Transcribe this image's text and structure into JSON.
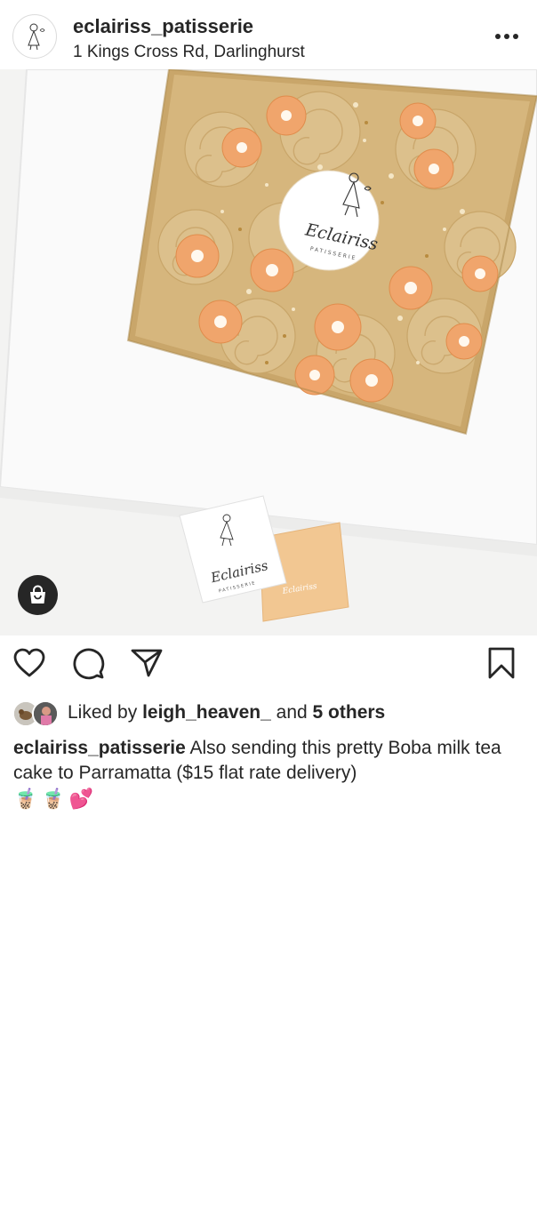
{
  "post": {
    "username": "eclairiss_patisserie",
    "location": "1 Kings Cross Rd, Darlinghurst",
    "image": {
      "logo_script": "Eclairiss",
      "logo_sub": "PATISSERIE"
    },
    "likes": {
      "prefix": "Liked by",
      "user": "leigh_heaven_",
      "joiner": "and",
      "others": "5 others"
    },
    "caption": {
      "username": "eclairiss_patisserie",
      "text": "Also sending this pretty Boba milk tea cake to Parramatta ($15 flat rate delivery)",
      "emojis": "🧋🧋💕"
    }
  },
  "icons": {
    "more": "more-horizontal-icon",
    "shop": "shopping-bag-icon",
    "like": "heart-icon",
    "comment": "comment-bubble-icon",
    "share": "paper-plane-icon",
    "save": "bookmark-icon"
  },
  "colors": {
    "text": "#262626",
    "frosting": "#d9b97f",
    "rosette": "#f0a56c",
    "badge": "#262626"
  }
}
